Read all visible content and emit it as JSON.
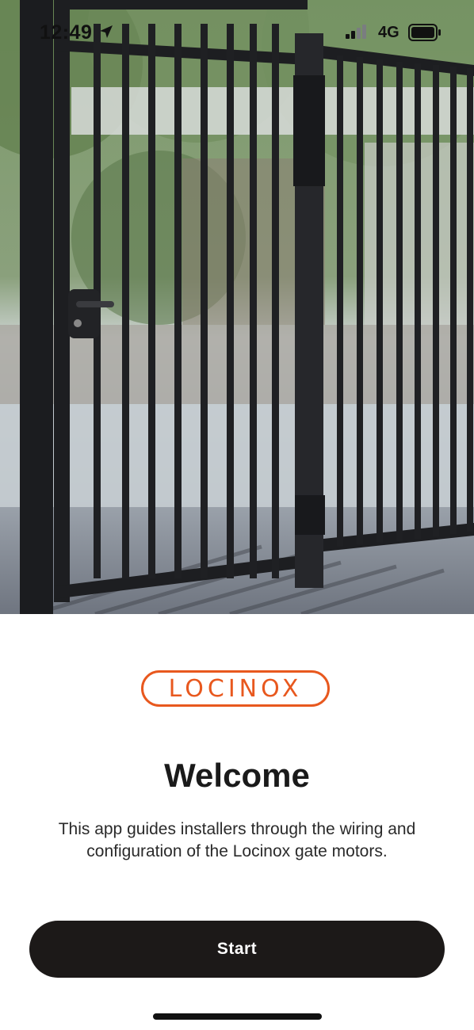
{
  "status_bar": {
    "time": "12:49",
    "network": "4G",
    "icons": [
      "location-arrow-icon",
      "signal-icon",
      "battery-icon"
    ]
  },
  "hero": {
    "image": "black-metal-gate-photo"
  },
  "brand": {
    "logo_text": "LOCINOX",
    "color": "#e8581e"
  },
  "welcome": {
    "title": "Welcome",
    "description": "This app guides installers through the wiring and configuration of the Locinox gate motors."
  },
  "actions": {
    "start_label": "Start",
    "button_color": "#1c1918"
  }
}
